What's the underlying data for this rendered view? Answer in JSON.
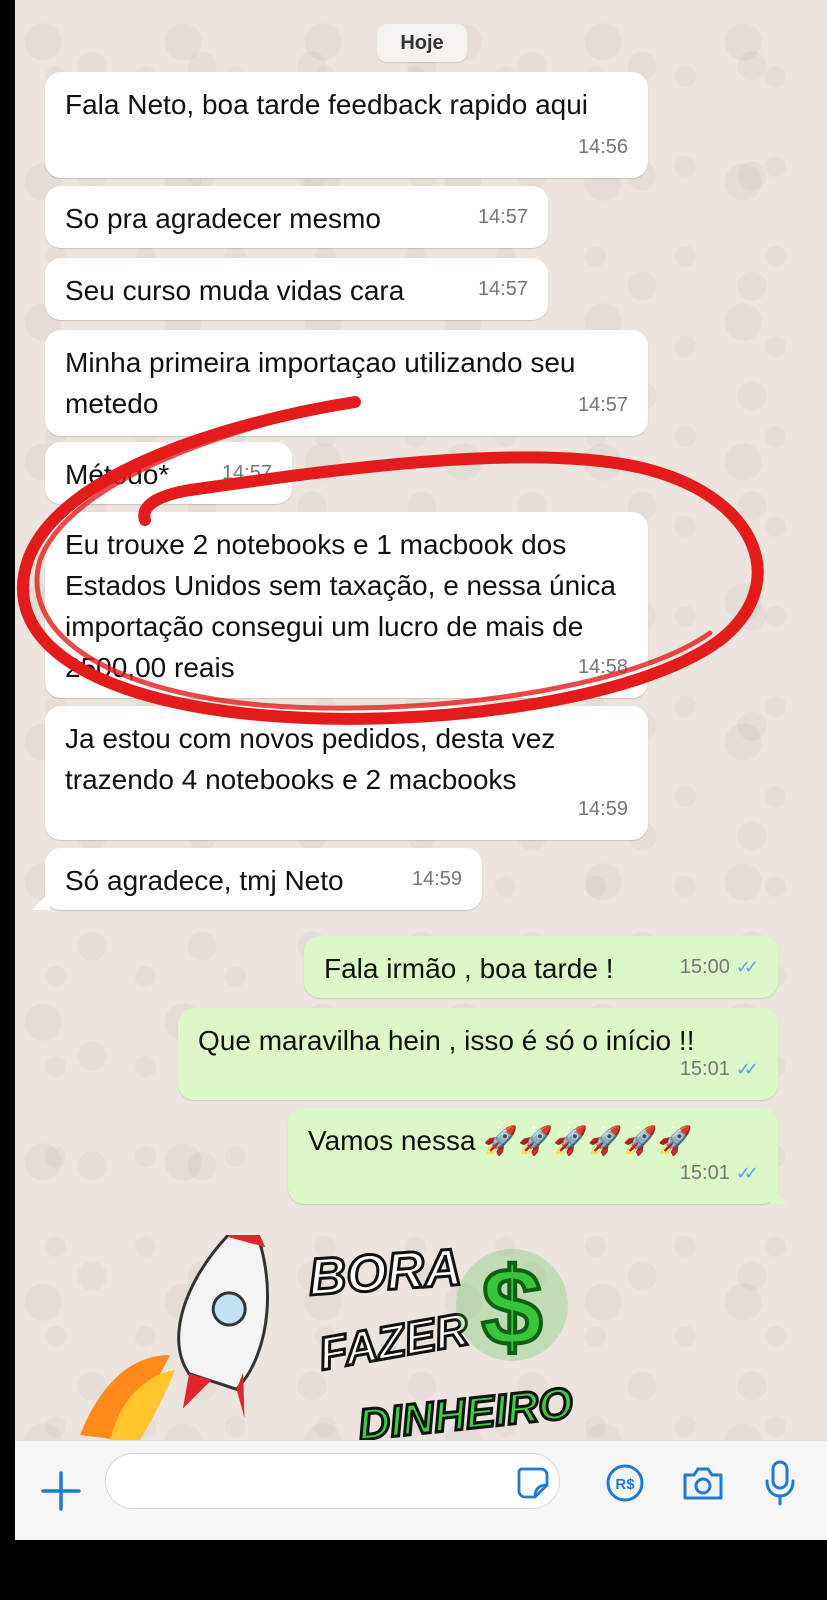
{
  "date_chip": "Hoje",
  "messages": [
    {
      "text": "Fala Neto, boa tarde feedback rapido aqui",
      "time": "14:56"
    },
    {
      "text": "So pra agradecer mesmo",
      "time": "14:57"
    },
    {
      "text": "Seu curso muda vidas cara",
      "time": "14:57"
    },
    {
      "text": "Minha primeira importaçao utilizando seu metedo",
      "time": "14:57"
    },
    {
      "text": "Método*",
      "time": "14:57"
    },
    {
      "text": "Eu trouxe 2 notebooks e 1 macbook dos Estados Unidos sem taxação, e nessa única importação consegui um lucro de mais de 2500,00 reais",
      "time": "14:58"
    },
    {
      "text": "Ja estou com novos pedidos, desta vez trazendo 4 notebooks e 2 macbooks",
      "time": "14:59"
    },
    {
      "text": "Só agradece, tmj Neto",
      "time": "14:59"
    },
    {
      "text": "Fala irmão , boa tarde !",
      "time": "15:00"
    },
    {
      "text": "Que maravilha hein , isso é só o início !!",
      "time": "15:01"
    },
    {
      "text": "Vamos nessa 🚀🚀🚀🚀🚀🚀",
      "time": "15:01"
    }
  ],
  "sticker": {
    "line1": "BORA",
    "line2": "FAZER",
    "line3": "DINHEIRO"
  },
  "colors": {
    "incoming_bubble": "#ffffff",
    "outgoing_bubble": "#dbf8c6",
    "read_ticks": "#53a6e8",
    "annotation_circle": "#e31b1b",
    "accent_blue": "#1e7ad6"
  },
  "input_bar": {
    "icons": [
      "plus-icon",
      "sticker-icon",
      "pix-icon",
      "camera-icon",
      "microphone-icon"
    ],
    "pix_label": "R$"
  }
}
